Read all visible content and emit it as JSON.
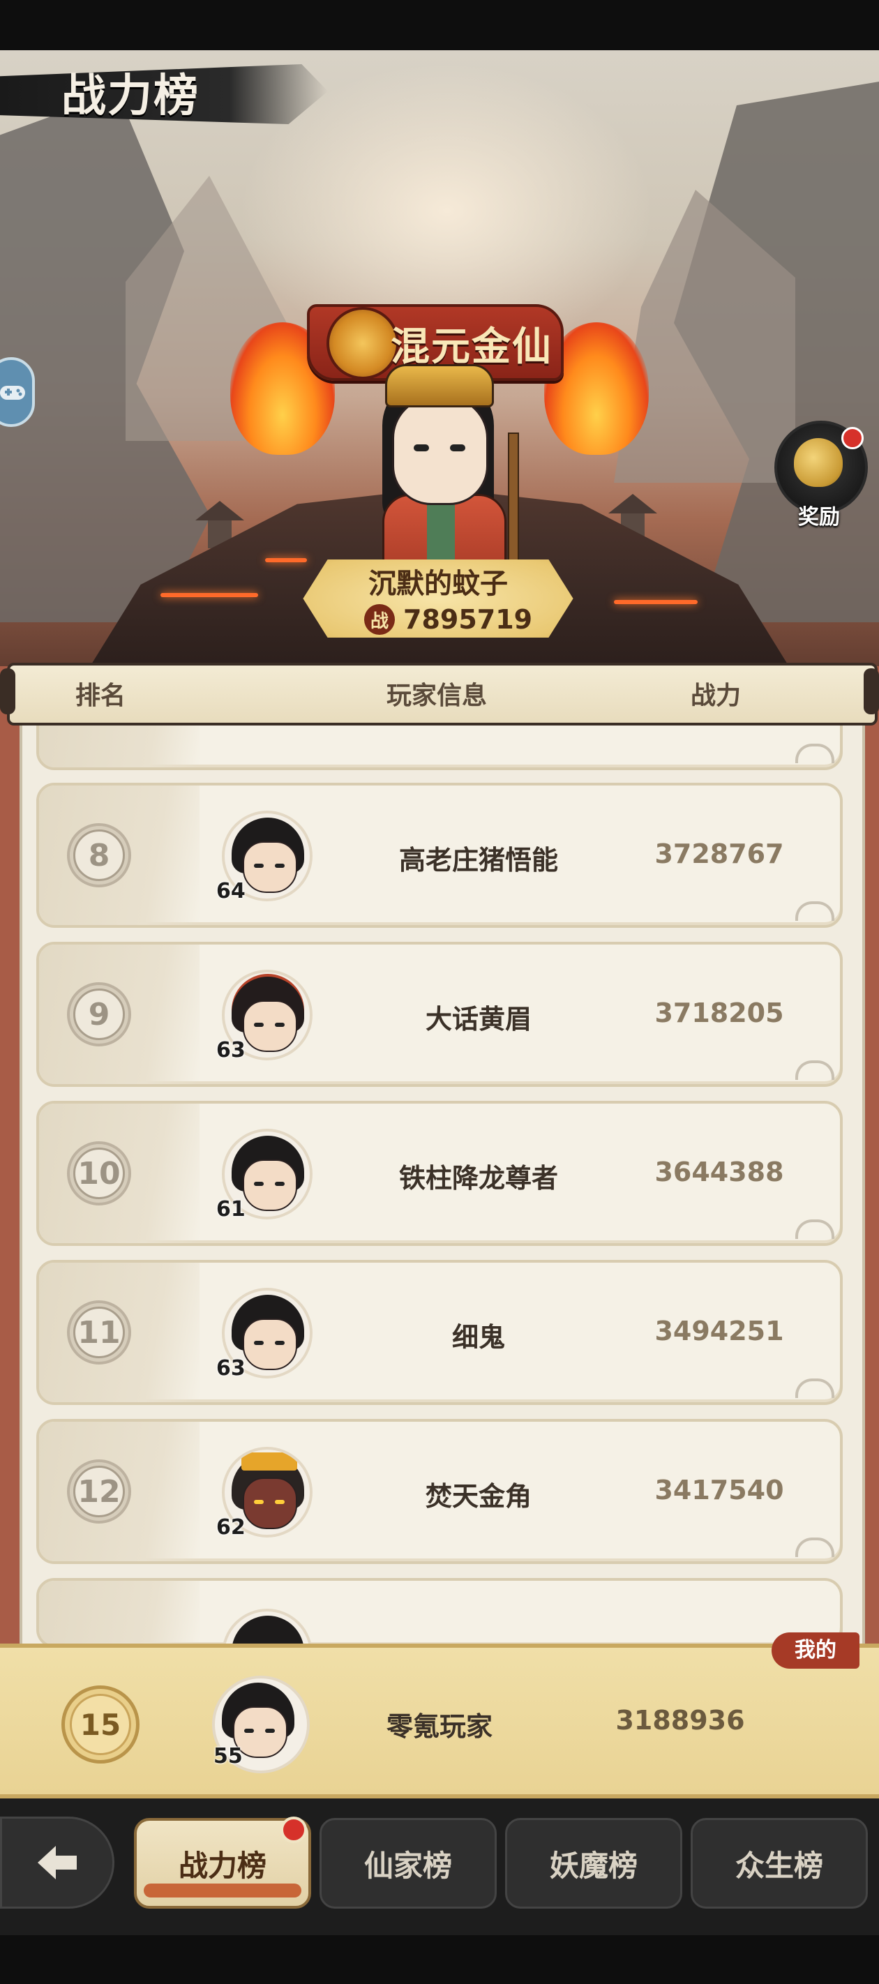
{
  "page": {
    "title": "战力榜"
  },
  "reward": {
    "label": "奖励",
    "icon": "money-bag-icon"
  },
  "champion": {
    "title": "混元金仙",
    "name": "沉默的蚊子",
    "power_icon": "战",
    "power": "7895719"
  },
  "table": {
    "headers": {
      "rank": "排名",
      "player": "玩家信息",
      "power": "战力"
    },
    "rows": [
      {
        "rank": "8",
        "level": "64",
        "name": "高老庄猪悟能",
        "power": "3728767"
      },
      {
        "rank": "9",
        "level": "63",
        "name": "大话黄眉",
        "power": "3718205"
      },
      {
        "rank": "10",
        "level": "61",
        "name": "铁柱降龙尊者",
        "power": "3644388"
      },
      {
        "rank": "11",
        "level": "63",
        "name": "细鬼",
        "power": "3494251"
      },
      {
        "rank": "12",
        "level": "62",
        "name": "焚天金角",
        "power": "3417540"
      }
    ]
  },
  "me": {
    "tag": "我的",
    "rank": "15",
    "level": "55",
    "name": "零氪玩家",
    "power": "3188936"
  },
  "tabs": [
    {
      "label": "战力榜",
      "active": true
    },
    {
      "label": "仙家榜",
      "active": false
    },
    {
      "label": "妖魔榜",
      "active": false
    },
    {
      "label": "众生榜",
      "active": false
    }
  ],
  "colors": {
    "accent": "#a63a26",
    "paper": "#f1ece0",
    "gold": "#e9d394"
  }
}
